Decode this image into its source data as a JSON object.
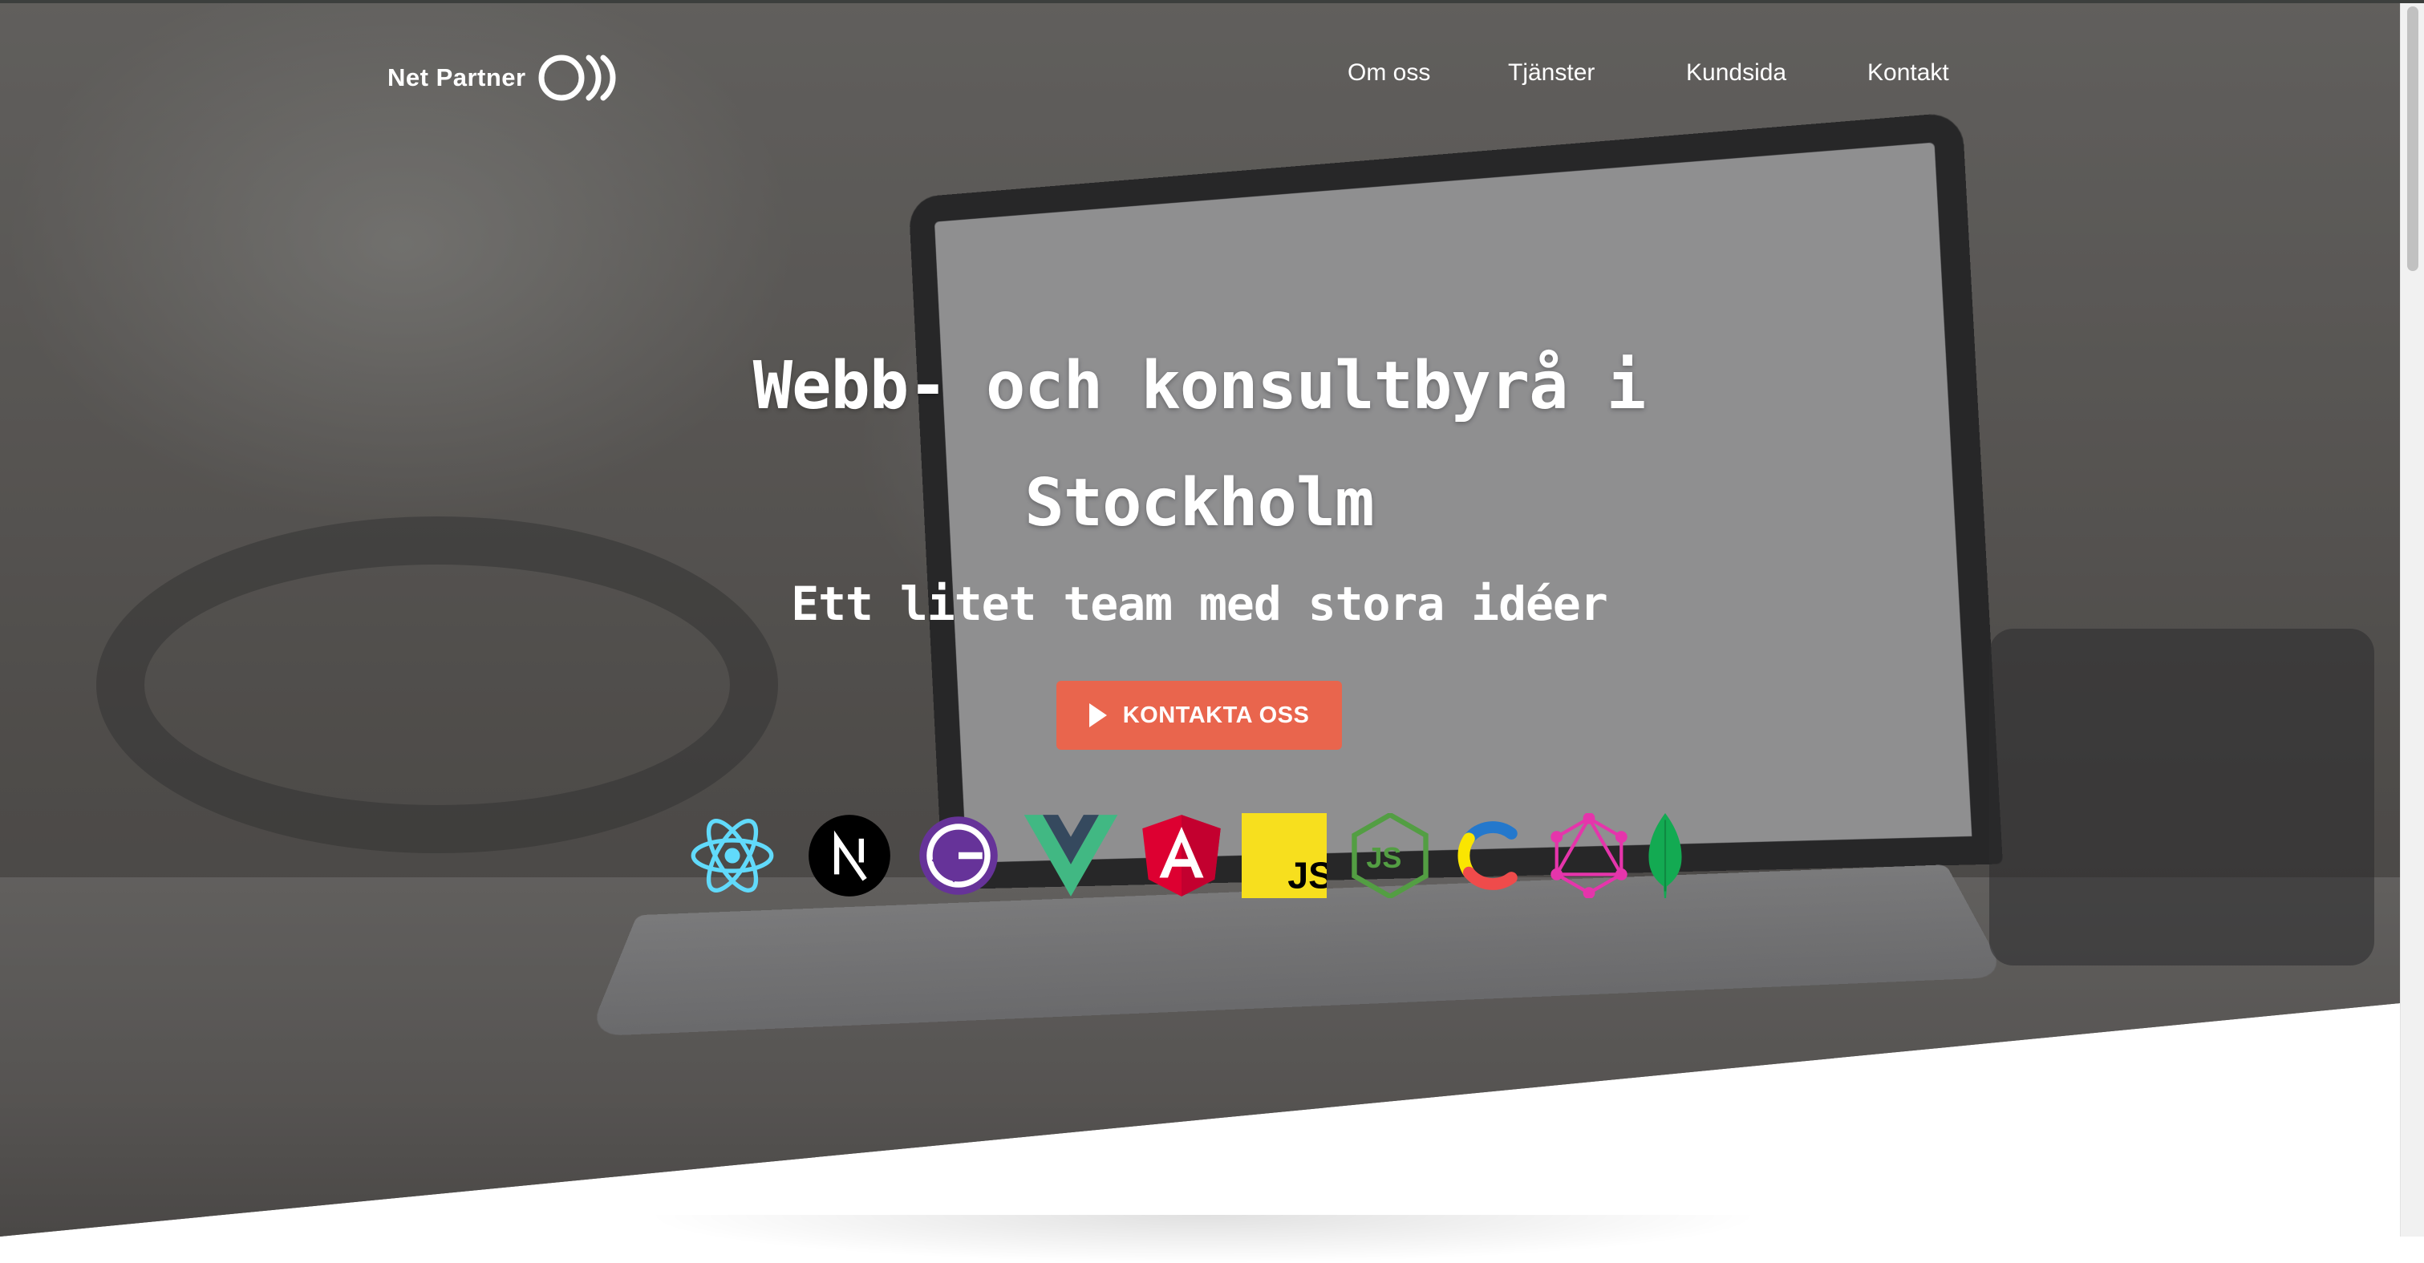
{
  "brand": {
    "name": "Net Partner",
    "icon": "net-partner-logo-icon"
  },
  "nav": {
    "items": [
      {
        "label": "Om oss"
      },
      {
        "label": "Tjänster"
      },
      {
        "label": "Kundsida"
      },
      {
        "label": "Kontakt"
      }
    ]
  },
  "hero": {
    "headline": "Webb- och konsultbyrå i Stockholm",
    "subline": "Ett litet team med stora idéer",
    "cta": {
      "label": "KONTAKTA OSS",
      "icon": "play-icon",
      "color": "#e9654d"
    },
    "tech_icons": [
      "react-icon",
      "nextjs-icon",
      "gatsby-icon",
      "vue-icon",
      "angular-icon",
      "javascript-icon",
      "nodejs-icon",
      "contentful-icon",
      "graphql-icon",
      "mongodb-icon"
    ]
  },
  "colors": {
    "accent": "#e9654d",
    "text": "#ffffff"
  }
}
